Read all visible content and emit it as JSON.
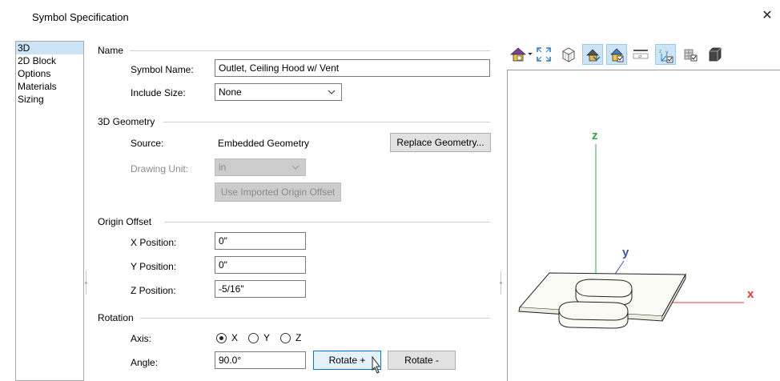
{
  "window": {
    "title": "Symbol Specification",
    "close_glyph": "✕"
  },
  "nav": {
    "items": [
      "3D",
      "2D Block",
      "Options",
      "Materials",
      "Sizing"
    ],
    "selected": "3D"
  },
  "name_section": {
    "label": "Name",
    "symbol_name_label": "Symbol Name:",
    "symbol_name_value": "Outlet, Ceiling Hood w/ Vent",
    "include_size_label": "Include Size:",
    "include_size_value": "None"
  },
  "geometry_section": {
    "label": "3D Geometry",
    "source_label": "Source:",
    "source_value": "Embedded Geometry",
    "replace_button": "Replace Geometry...",
    "drawing_unit_label": "Drawing Unit:",
    "drawing_unit_value": "in",
    "use_offset_button": "Use Imported Origin Offset"
  },
  "origin_section": {
    "label": "Origin Offset",
    "x_label": "X Position:",
    "x_value": "0\"",
    "y_label": "Y Position:",
    "y_value": "0\"",
    "z_label": "Z Position:",
    "z_value": "-5/16\""
  },
  "rotation_section": {
    "label": "Rotation",
    "axis_label": "Axis:",
    "axis_options": [
      "X",
      "Y",
      "Z"
    ],
    "axis_selected": "X",
    "angle_label": "Angle:",
    "angle_value": "90.0°",
    "rotate_plus": "Rotate +",
    "rotate_minus": "Rotate -"
  },
  "viewer": {
    "axis_labels": {
      "x": "x",
      "y": "y",
      "z": "z"
    },
    "axis_colors": {
      "x": "#e53935",
      "y": "#3f51b5",
      "z": "#2ea84a"
    },
    "toolbar_icons": [
      "camera-view-icon",
      "fill-window-icon",
      "wireframe-icon",
      "render-icon",
      "show-outline-icon",
      "show-floor-icon",
      "show-axes-icon",
      "materials-icon",
      "box-icon"
    ]
  }
}
